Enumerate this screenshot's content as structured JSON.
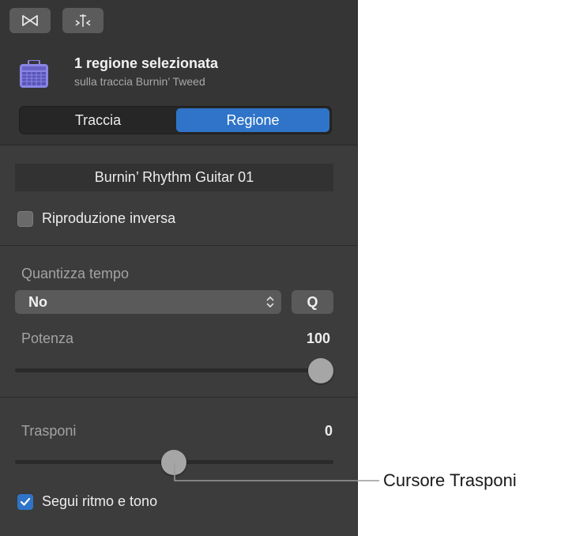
{
  "toolbar": {
    "buttons": [
      {
        "icon": "bowtie-icon"
      },
      {
        "icon": "split-icon"
      }
    ]
  },
  "header": {
    "icon": "amplifier-icon",
    "title": "1 regione selezionata",
    "subtitle": "sulla traccia Burnin’ Tweed"
  },
  "tabs": [
    {
      "label": "Traccia",
      "active": false
    },
    {
      "label": "Regione",
      "active": true
    }
  ],
  "region": {
    "name": "Burnin’ Rhythm Guitar 01",
    "reverse_label": "Riproduzione inversa",
    "reverse_checked": false
  },
  "quantize": {
    "label": "Quantizza tempo",
    "selected": "No",
    "q_button": "Q",
    "strength_label": "Potenza",
    "strength_value": "100"
  },
  "transpose": {
    "label": "Trasponi",
    "value": "0"
  },
  "follow": {
    "label": "Segui ritmo e tono",
    "checked": true
  },
  "callout": {
    "label": "Cursore Trasponi"
  },
  "colors": {
    "accent": "#2f74c8",
    "panel": "#3c3c3c"
  }
}
